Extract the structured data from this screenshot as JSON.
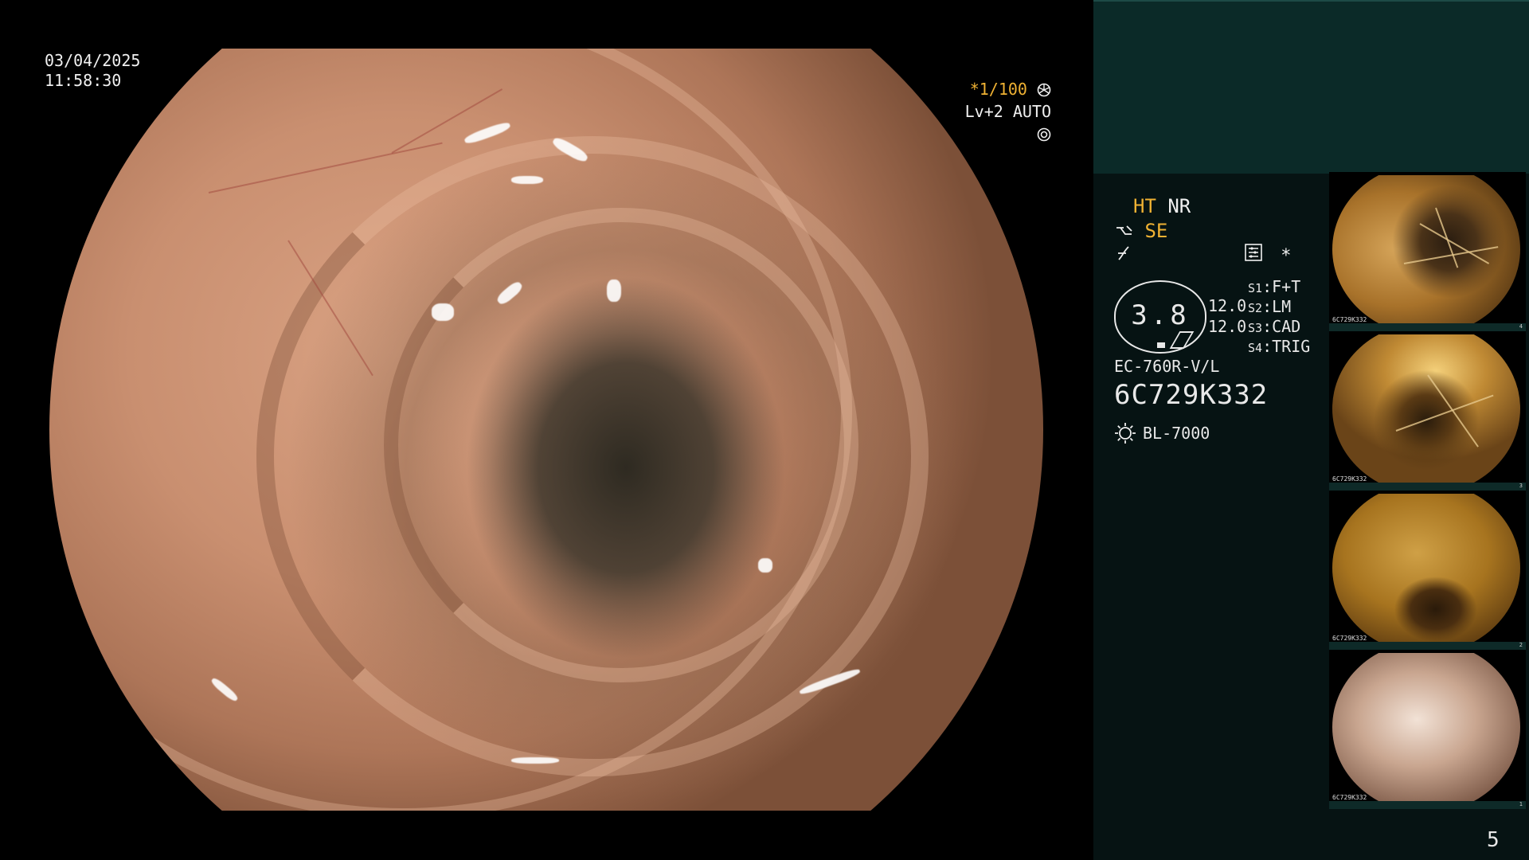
{
  "overlay": {
    "date": "03/04/2025",
    "time": "11:58:30",
    "shutter": "*1/100",
    "shutter_icon": "aperture-icon",
    "iris": "Lv+2 AUTO",
    "iris_icon": "iris-icon"
  },
  "panel": {
    "mode_ht": "HT",
    "mode_nr": "NR",
    "mode_se": "SE",
    "mode_se_icon": "edge-enhance-icon",
    "mode_f_icon": "f-hook-icon",
    "menu_icon": "settings-panel-icon",
    "star": "*",
    "zoom_value": "3.8",
    "numbers": [
      "12.0",
      "12.0"
    ],
    "switches": [
      {
        "key": "S1",
        "value": "F+T"
      },
      {
        "key": "S2",
        "value": "LM"
      },
      {
        "key": "S3",
        "value": "CAD"
      },
      {
        "key": "S4",
        "value": "TRIG"
      }
    ],
    "scope_model": "EC-760R-V/L",
    "scope_serial": "6C729K332",
    "light_icon": "lamp-icon",
    "light_source": "BL-7000",
    "page_number": "5"
  },
  "thumbnails": [
    {
      "label": "6C729K332",
      "index": "4"
    },
    {
      "label": "6C729K332",
      "index": "3"
    },
    {
      "label": "6C729K332",
      "index": "2"
    },
    {
      "label": "6C729K332",
      "index": "1"
    }
  ],
  "colors": {
    "accent_orange": "#f0b233",
    "panel_bg": "#061313",
    "panel_top": "#0b2a28"
  }
}
